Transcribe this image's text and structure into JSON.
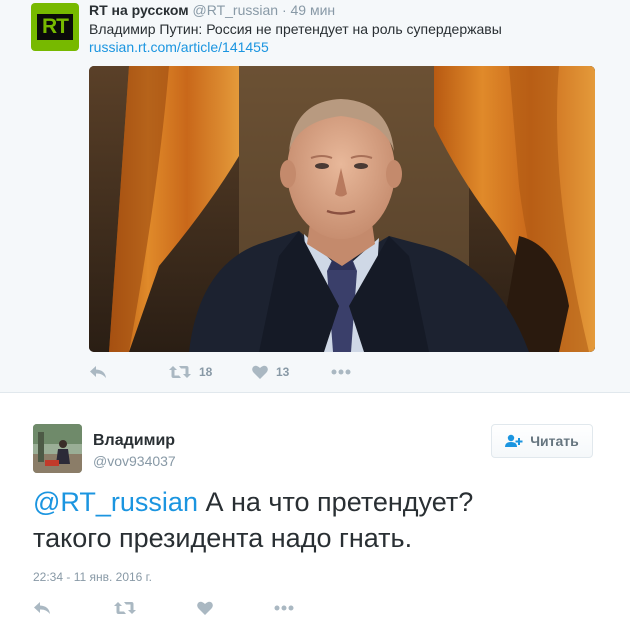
{
  "parent_tweet": {
    "avatar_logo_text": "RT",
    "author_name": "RT на русском",
    "author_handle": "@RT_russian",
    "separator": "·",
    "time": "49 мин",
    "text": "Владимир Путин: Россия не претендует на роль супердержавы",
    "link": "russian.rt.com/article/141455",
    "retweet_count": "18",
    "like_count": "13",
    "actions_icons": [
      "reply-icon",
      "retweet-icon",
      "heart-icon",
      "more-icon"
    ]
  },
  "reply_tweet": {
    "author_name": "Владимир",
    "author_handle": "@vov934037",
    "follow_label": "Читать",
    "mention": "@RT_russian",
    "text_line1": " А на что претендует?",
    "text_line2": "такого президента надо гнать.",
    "date": "22:34 - 11 янв. 2016 г.",
    "actions_icons": [
      "reply-icon",
      "retweet-icon",
      "heart-icon",
      "more-icon"
    ]
  },
  "colors": {
    "link": "#1b95e0",
    "muted": "#8899a6",
    "icon": "#aab8c2",
    "text": "#292f33",
    "rt_green": "#77b900"
  }
}
